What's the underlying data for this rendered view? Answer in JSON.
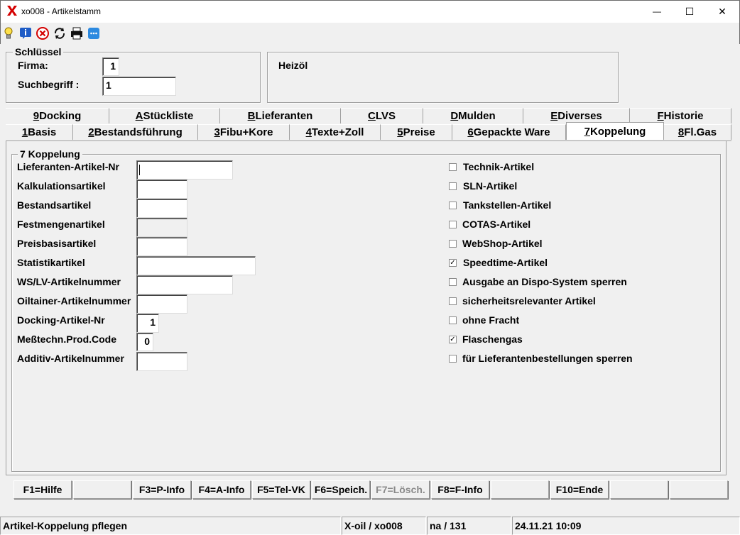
{
  "window": {
    "title": "xo008 - Artikelstamm",
    "app_icon": "red-x-icon",
    "controls": {
      "minimize": "—",
      "maximize": "☐",
      "close": "✕"
    }
  },
  "toolbar": {
    "icons": [
      "lightbulb-icon",
      "info-icon",
      "cancel-icon",
      "refresh-icon",
      "printer-icon",
      "chat-icon"
    ]
  },
  "key_group": {
    "title": "Schlüssel",
    "firma_label": "Firma:",
    "firma_value": "1",
    "suchbegriff_label": "Suchbegriff :",
    "suchbegriff_value": "1"
  },
  "product": {
    "name": "Heizöl"
  },
  "tabs_row1": [
    {
      "key": "9",
      "label": " Docking"
    },
    {
      "key": "A",
      "label": " Stückliste"
    },
    {
      "key": "B",
      "label": " Lieferanten"
    },
    {
      "key": "C",
      "label": " LVS"
    },
    {
      "key": "D",
      "label": " Mulden"
    },
    {
      "key": "E",
      "label": " Diverses"
    },
    {
      "key": "F",
      "label": " Historie"
    }
  ],
  "tabs_row2": [
    {
      "key": "1",
      "label": " Basis"
    },
    {
      "key": "2",
      "label": " Bestandsführung"
    },
    {
      "key": "3",
      "label": " Fibu+Kore"
    },
    {
      "key": "4",
      "label": " Texte+Zoll"
    },
    {
      "key": "5",
      "label": " Preise"
    },
    {
      "key": "6",
      "label": " Gepackte Ware"
    },
    {
      "key": "7",
      "label": " Koppelung"
    },
    {
      "key": "8",
      "label": " Fl.Gas"
    }
  ],
  "active_tab": "7 Koppelung",
  "panel": {
    "title": "7 Koppelung",
    "fields": [
      {
        "label": "Lieferanten-Artikel-Nr",
        "value": ""
      },
      {
        "label": "Kalkulationsartikel",
        "value": ""
      },
      {
        "label": "Bestandsartikel",
        "value": ""
      },
      {
        "label": "Festmengenartikel",
        "value": ""
      },
      {
        "label": "Preisbasisartikel",
        "value": ""
      },
      {
        "label": "Statistikartikel",
        "value": ""
      },
      {
        "label": "WS/LV-Artikelnummer",
        "value": ""
      },
      {
        "label": "Oiltainer-Artikelnummer",
        "value": ""
      },
      {
        "label": "Docking-Artikel-Nr",
        "value": "1"
      },
      {
        "label": "Meßtechn.Prod.Code",
        "value": "0"
      },
      {
        "label": "Additiv-Artikelnummer",
        "value": ""
      }
    ],
    "checkboxes": [
      {
        "label": "Technik-Artikel",
        "checked": false,
        "mark": ""
      },
      {
        "label": "SLN-Artikel",
        "checked": false,
        "mark": ""
      },
      {
        "label": "Tankstellen-Artikel",
        "checked": false,
        "mark": ""
      },
      {
        "label": "COTAS-Artikel",
        "checked": false,
        "mark": ""
      },
      {
        "label": "WebShop-Artikel",
        "checked": false,
        "mark": ""
      },
      {
        "label": "Speedtime-Artikel",
        "checked": true,
        "mark": "✓"
      },
      {
        "label": "Ausgabe an Dispo-System sperren",
        "checked": false,
        "mark": ""
      },
      {
        "label": "sicherheitsrelevanter Artikel",
        "checked": false,
        "mark": ""
      },
      {
        "label": "ohne Fracht",
        "checked": false,
        "mark": ""
      },
      {
        "label": "Flaschengas",
        "checked": true,
        "mark": "✓"
      },
      {
        "label": "für Lieferantenbestellungen sperren",
        "checked": false,
        "mark": ""
      }
    ]
  },
  "function_keys": [
    {
      "label": "F1=Hilfe",
      "enabled": true
    },
    {
      "label": "",
      "enabled": true
    },
    {
      "label": "F3=P-Info",
      "enabled": true
    },
    {
      "label": "F4=A-Info",
      "enabled": true
    },
    {
      "label": "F5=Tel-VK",
      "enabled": true
    },
    {
      "label": "F6=Speich.",
      "enabled": true
    },
    {
      "label": "F7=Lösch.",
      "enabled": false
    },
    {
      "label": "F8=F-Info",
      "enabled": true
    },
    {
      "label": "",
      "enabled": true
    },
    {
      "label": "F10=Ende",
      "enabled": true
    },
    {
      "label": "",
      "enabled": true
    },
    {
      "label": "",
      "enabled": true
    }
  ],
  "status_bar": {
    "message": "Artikel-Koppelung pflegen",
    "system": "X-oil / xo008",
    "user": "na / 131",
    "datetime": "24.11.21 10:09"
  }
}
